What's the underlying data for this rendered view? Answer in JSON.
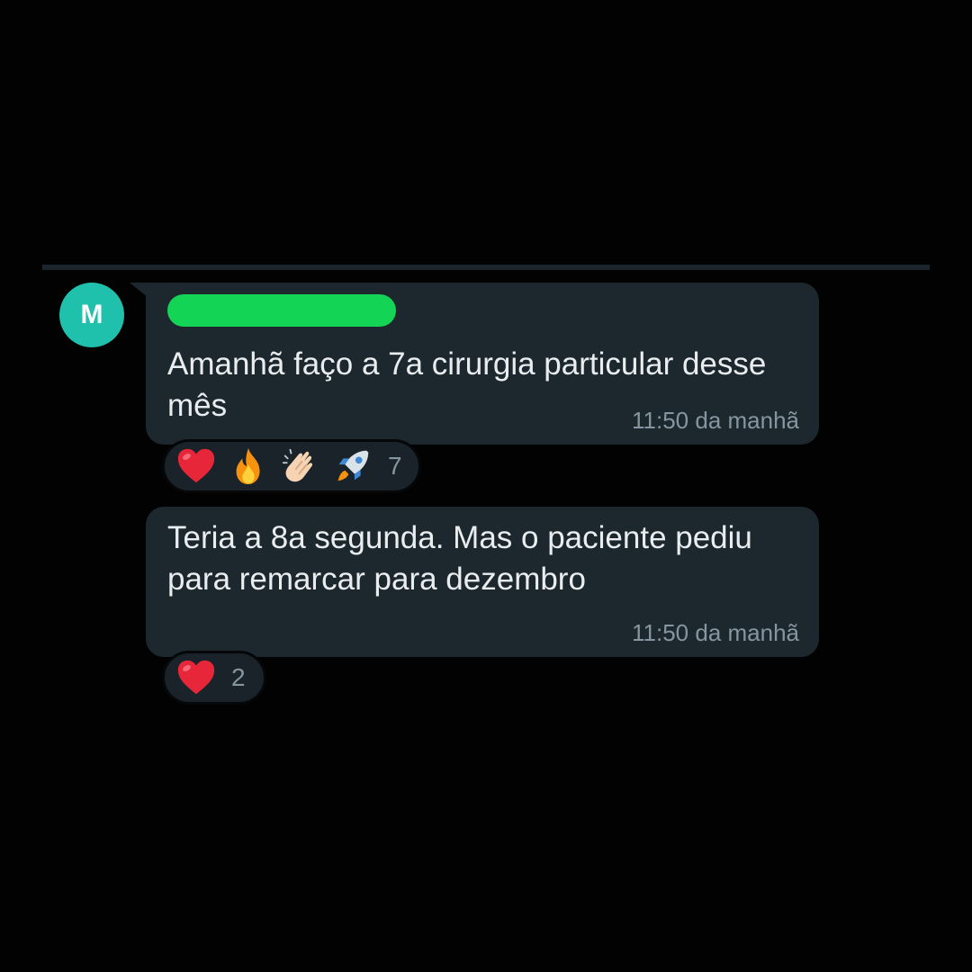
{
  "chat": {
    "avatar_letter": "M",
    "messages": [
      {
        "text": "Amanhã faço a 7a cirurgia particular desse mês",
        "time": "11:50 da manhã",
        "reactions": [
          "heart",
          "fire",
          "clapping-hands",
          "rocket"
        ],
        "reaction_count": "7"
      },
      {
        "text": "Teria a 8a segunda. Mas o paciente pediu para remarcar para dezembro",
        "time": "11:50 da manhã",
        "reactions": [
          "heart"
        ],
        "reaction_count": "2"
      }
    ]
  },
  "colors": {
    "background": "#020203",
    "bubble": "#1d282e",
    "avatar": "#1fc0ac",
    "redaction": "#13d455",
    "text": "#e9edef",
    "meta": "#8696a0"
  },
  "icons": {
    "heart": "heart-icon",
    "fire": "fire-icon",
    "clap": "clapping-hands-icon",
    "rocket": "rocket-icon"
  }
}
